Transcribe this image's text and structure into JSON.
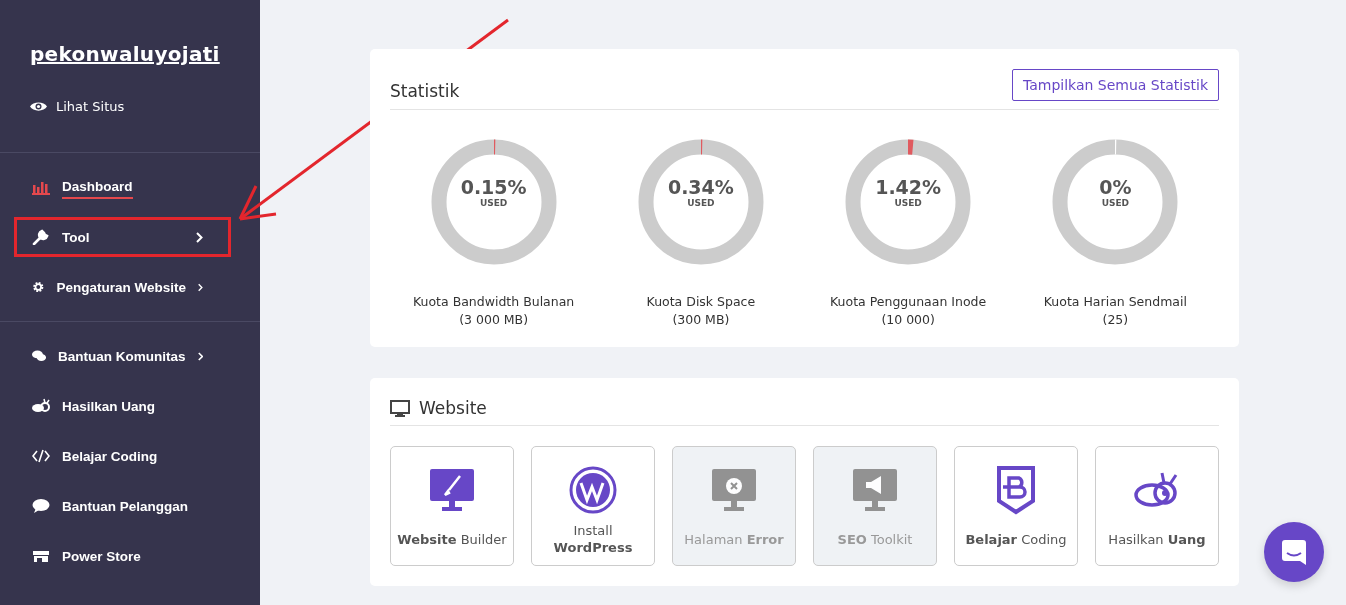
{
  "sidebar": {
    "site_name": "pekonwaluyojati",
    "view_site": "Lihat Situs",
    "groups": [
      [
        {
          "label": "Dashboard",
          "selected": true,
          "has_submenu": false,
          "highlighted": false
        },
        {
          "label": "Tool",
          "selected": false,
          "has_submenu": true,
          "highlighted": true
        },
        {
          "label": "Pengaturan Website",
          "selected": false,
          "has_submenu": true,
          "highlighted": false
        }
      ],
      [
        {
          "label": "Bantuan Komunitas",
          "selected": false,
          "has_submenu": true,
          "highlighted": false
        },
        {
          "label": "Hasilkan Uang",
          "selected": false,
          "has_submenu": false,
          "highlighted": false
        },
        {
          "label": "Belajar Coding",
          "selected": false,
          "has_submenu": false,
          "highlighted": false
        },
        {
          "label": "Bantuan Pelanggan",
          "selected": false,
          "has_submenu": false,
          "highlighted": false
        },
        {
          "label": "Power Store",
          "selected": false,
          "has_submenu": false,
          "highlighted": false
        }
      ]
    ]
  },
  "statistics": {
    "title": "Statistik",
    "button": "Tampilkan Semua Statistik",
    "gauges": [
      {
        "value": "0.15%",
        "caption": "USED",
        "label": "Kuota Bandwidth Bulanan",
        "limit": "(3 000 MB)",
        "level": 0.0015
      },
      {
        "value": "0.34%",
        "caption": "USED",
        "label": "Kuota Disk Space",
        "limit": "(300 MB)",
        "level": 0.0034
      },
      {
        "value": "1.42%",
        "caption": "USED",
        "label": "Kuota Penggunaan Inode",
        "limit": "(10 000)",
        "level": 0.0142
      },
      {
        "value": "0%",
        "caption": "USED",
        "label": "Kuota Harian Sendmail",
        "limit": "(25)",
        "level": 0
      }
    ]
  },
  "website": {
    "title": "Website",
    "tiles": [
      {
        "label": "**Website** Builder",
        "disabled": false
      },
      {
        "label": "Install",
        "label_2": "WordPress",
        "disabled": false
      },
      {
        "label": "Halaman **Error**",
        "disabled": true
      },
      {
        "label": "**SEO** Toolkit",
        "disabled": true
      },
      {
        "label": "**Belajar** Coding",
        "disabled": false
      },
      {
        "label": "Hasilkan **Uang**",
        "disabled": false
      }
    ]
  }
}
